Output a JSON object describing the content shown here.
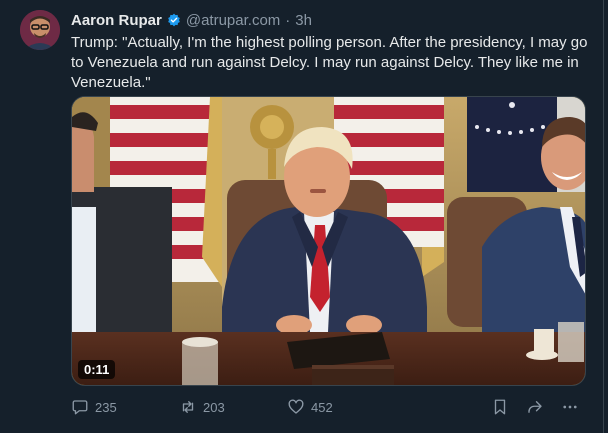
{
  "post": {
    "author_name": "Aaron Rupar",
    "handle": "@atrupar.com",
    "separator": "·",
    "time_ago": "3h",
    "text": "Trump: \"Actually, I'm the highest polling person. After the presidency, I may go to Venezuela and run against Delcy. I may run against Delcy. They like me in Venezuela.\"",
    "video_timestamp": "0:11"
  },
  "actions": {
    "replies": "235",
    "reposts": "203",
    "likes": "452"
  },
  "icons": {
    "verified": "verified-badge-icon",
    "reply": "reply-icon",
    "repost": "repost-icon",
    "like": "heart-icon",
    "bookmark": "bookmark-icon",
    "share": "share-icon",
    "more": "more-icon"
  },
  "colors": {
    "background": "#15202b",
    "verified_badge": "#1d9bf0",
    "muted_text": "#8b98a5"
  }
}
